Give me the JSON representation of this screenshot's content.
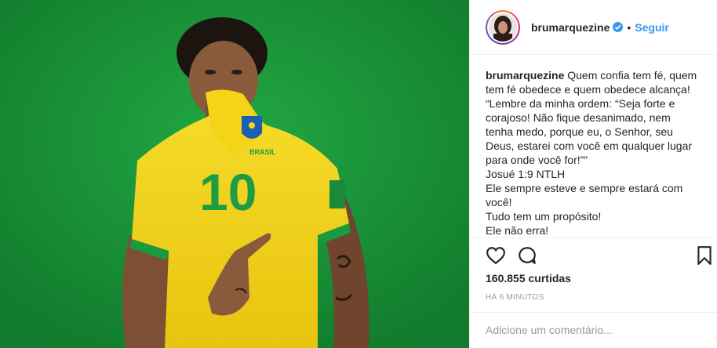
{
  "post": {
    "username": "brumarquezine",
    "separator": "•",
    "follow_label": "Seguir",
    "caption_user": "brumarquezine",
    "caption_lines": [
      "Quem confia tem fé, quem",
      "tem fé obedece e quem obedece alcança!",
      "“Lembre da minha ordem: “Seja forte e",
      "corajoso! Não fique desanimado, nem",
      "tenha medo, porque eu, o Senhor, seu",
      "Deus, estarei com você em qualquer lugar",
      "para onde você for!””",
      "Josué 1:9 NTLH",
      "Ele sempre esteve e sempre estará com",
      "você!",
      "Tudo tem um propósito!",
      "Ele não erra!"
    ],
    "likes": "160.855 curtidas",
    "time": "HÁ 6 MINUTOS",
    "comment_placeholder": "Adicione um comentário..."
  },
  "photo": {
    "jersey_number": "10",
    "jersey_text": "BRASIL"
  },
  "colors": {
    "background_green": "#18963a",
    "jersey_yellow": "#f3d417",
    "accent_blue": "#3897f0",
    "verified_blue": "#3897f0"
  },
  "icons": {
    "like": "heart-icon",
    "comment": "comment-icon",
    "save": "bookmark-icon",
    "verified": "verified-badge-icon"
  }
}
